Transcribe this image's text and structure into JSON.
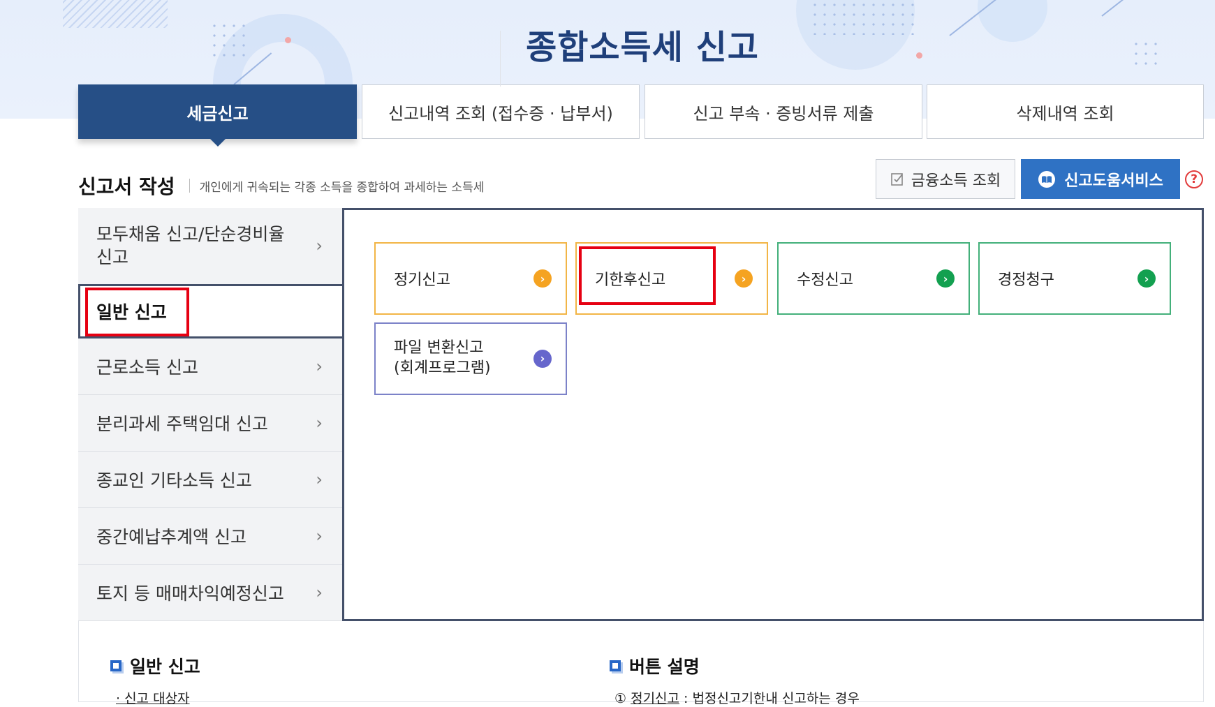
{
  "header": {
    "title": "종합소득세 신고"
  },
  "tabs": [
    {
      "label": "세금신고",
      "active": true
    },
    {
      "label": "신고내역 조회 (접수증 · 납부서)",
      "active": false
    },
    {
      "label": "신고 부속 · 증빙서류 제출",
      "active": false
    },
    {
      "label": "삭제내역 조회",
      "active": false
    }
  ],
  "section": {
    "title": "신고서 작성",
    "description": "개인에게 귀속되는 각종 소득을 종합하여 과세하는 소득세"
  },
  "actions": {
    "financial_income_label": "금융소득 조회",
    "help_service_label": "신고도움서비스",
    "help_icon_glyph": "?"
  },
  "sidenav": [
    {
      "label": "모두채움 신고/단순경비율 신고"
    },
    {
      "label": "일반 신고",
      "active": true
    },
    {
      "label": "근로소득 신고"
    },
    {
      "label": "분리과세 주택임대 신고"
    },
    {
      "label": "종교인 기타소득 신고"
    },
    {
      "label": "중간예납추계액 신고"
    },
    {
      "label": "토지 등 매매차익예정신고"
    }
  ],
  "cards": [
    {
      "label": "정기신고",
      "color": "orange"
    },
    {
      "label": "기한후신고",
      "color": "orange",
      "highlighted": true
    },
    {
      "label": "수정신고",
      "color": "green"
    },
    {
      "label": "경정청구",
      "color": "green"
    },
    {
      "label_line1": "파일 변환신고",
      "label_line2": "(회계프로그램)",
      "color": "purple"
    }
  ],
  "info": {
    "left_title": "일반 신고",
    "left_sub": "· 신고 대상자",
    "right_title": "버튼 설명",
    "right_sub_num": "①",
    "right_sub_link": "정기신고",
    "right_sub_text": " : 법정신고기한내 신고하는 경우"
  },
  "colors": {
    "primary_navy": "#264f86",
    "help_blue": "#2f72c4",
    "orange": "#f5a321",
    "green": "#13a050",
    "purple": "#6666cc",
    "highlight_red": "#e60012"
  },
  "icons": {
    "chevron": "chevron-right-icon",
    "check": "check-doc-icon",
    "book": "book-icon",
    "question": "question-icon"
  }
}
